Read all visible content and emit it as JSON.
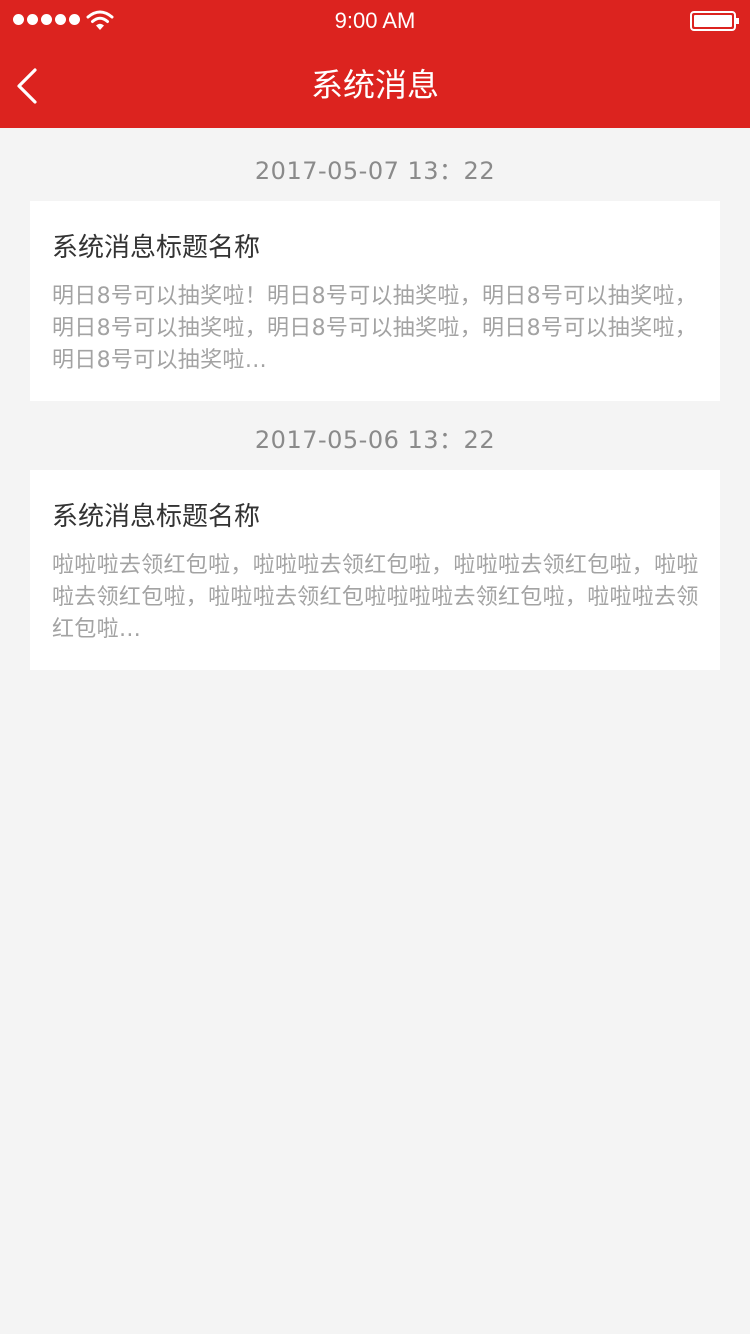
{
  "status_bar": {
    "time": "9:00 AM",
    "signal_icon": "signal-dots-icon",
    "wifi_icon": "wifi-icon",
    "battery_icon": "battery-icon"
  },
  "nav": {
    "title": "系统消息",
    "back_icon": "chevron-left-icon"
  },
  "messages": [
    {
      "timestamp": "2017-05-07 13：22",
      "title": "系统消息标题名称",
      "body": "明日8号可以抽奖啦！明日8号可以抽奖啦，明日8号可以抽奖啦，明日8号可以抽奖啦，明日8号可以抽奖啦，明日8号可以抽奖啦，明日8号可以抽奖啦…"
    },
    {
      "timestamp": "2017-05-06 13：22",
      "title": "系统消息标题名称",
      "body": "啦啦啦去领红包啦，啦啦啦去领红包啦，啦啦啦去领红包啦，啦啦啦去领红包啦，啦啦啦去领红包啦啦啦啦去领红包啦，啦啦啦去领红包啦…"
    }
  ],
  "colors": {
    "brand_red": "#dc231f",
    "background": "#f4f4f4",
    "card": "#ffffff",
    "title_text": "#333333",
    "body_text": "#a3a3a3",
    "timestamp_text": "#8a8a8a"
  }
}
